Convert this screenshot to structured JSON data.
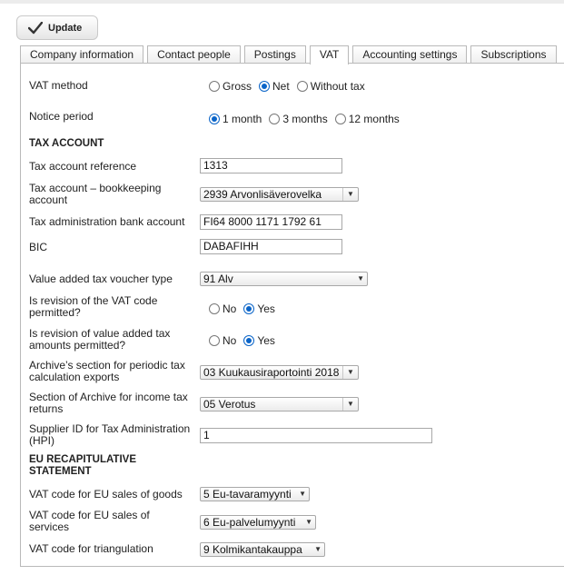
{
  "toolbar": {
    "update_label": "Update"
  },
  "tabs": [
    {
      "label": "Company information"
    },
    {
      "label": "Contact people"
    },
    {
      "label": "Postings"
    },
    {
      "label": "VAT"
    },
    {
      "label": "Accounting settings"
    },
    {
      "label": "Subscriptions"
    }
  ],
  "vat_method": {
    "label": "VAT method",
    "options": [
      "Gross",
      "Net",
      "Without tax"
    ],
    "selected": "Net"
  },
  "notice_period": {
    "label": "Notice period",
    "options": [
      "1 month",
      "3 months",
      "12 months"
    ],
    "selected": "1 month"
  },
  "tax_account": {
    "heading": "TAX ACCOUNT",
    "reference_label": "Tax account reference",
    "reference_value": "1313",
    "bookkeeping_label": "Tax account – bookkeeping account",
    "bookkeeping_value": "2939 Arvonlisäverovelka",
    "bank_account_label": "Tax administration bank account",
    "bank_account_value": "FI64 8000 1171 1792 61",
    "bic_label": "BIC",
    "bic_value": "DABAFIHH",
    "voucher_type_label": "Value added tax voucher type",
    "voucher_type_value": "91 Alv",
    "vat_code_revision_label": "Is revision of the VAT code permitted?",
    "vat_code_revision_options": [
      "No",
      "Yes"
    ],
    "vat_code_revision_selected": "Yes",
    "vat_amount_revision_label": "Is revision of value added tax amounts permitted?",
    "vat_amount_revision_options": [
      "No",
      "Yes"
    ],
    "vat_amount_revision_selected": "Yes",
    "archive_periodic_label": "Archive’s section for periodic tax calculation exports",
    "archive_periodic_value": "03 Kuukausiraportointi 2018",
    "archive_income_label": "Section of Archive for income tax returns",
    "archive_income_value": "05 Verotus",
    "supplier_id_label": "Supplier ID for Tax Administration (HPI)",
    "supplier_id_value": "1"
  },
  "eu_statement": {
    "heading": "EU RECAPITULATIVE STATEMENT",
    "goods_label": "VAT code for EU sales of goods",
    "goods_value": "5 Eu-tavaramyynti",
    "services_label": "VAT code for EU sales of services",
    "services_value": "6 Eu-palvelumyynti",
    "triangulation_label": "VAT code for triangulation",
    "triangulation_value": "9 Kolmikantakauppa"
  },
  "icons": {
    "update": "checkmark-icon",
    "dropdown": "chevron-down-icon"
  }
}
